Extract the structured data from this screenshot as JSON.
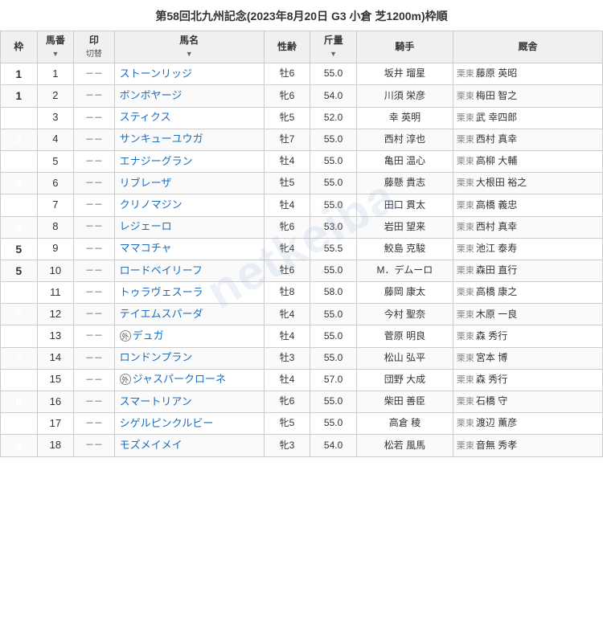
{
  "title": "第58回北九州記念(2023年8月20日 G3 小倉 芝1200m)枠順",
  "headers": {
    "waku": "枠",
    "bango": "馬番",
    "in": "印",
    "in_sub": "切替",
    "name": "馬名",
    "sex_age": "性齢",
    "weight": "斤量",
    "jockey": "騎手",
    "stable": "厩舎"
  },
  "horses": [
    {
      "waku": 1,
      "bango": 1,
      "in": "－－",
      "name": "ストーンリッジ",
      "sex_age": "牡6",
      "weight": "55.0",
      "jockey": "坂井 瑠星",
      "stable_region": "栗東",
      "stable": "藤原 英昭",
      "foreign": false
    },
    {
      "waku": 1,
      "bango": 2,
      "in": "－－",
      "name": "ボンボヤージ",
      "sex_age": "牝6",
      "weight": "54.0",
      "jockey": "川須 栄彦",
      "stable_region": "栗東",
      "stable": "梅田 智之",
      "foreign": false
    },
    {
      "waku": 2,
      "bango": 3,
      "in": "－－",
      "name": "スティクス",
      "sex_age": "牝5",
      "weight": "52.0",
      "jockey": "幸 英明",
      "stable_region": "栗東",
      "stable": "武 幸四郎",
      "foreign": false
    },
    {
      "waku": 2,
      "bango": 4,
      "in": "－－",
      "name": "サンキューユウガ",
      "sex_age": "牡7",
      "weight": "55.0",
      "jockey": "西村 淳也",
      "stable_region": "栗東",
      "stable": "西村 真幸",
      "foreign": false
    },
    {
      "waku": 3,
      "bango": 5,
      "in": "－－",
      "name": "エナジーグラン",
      "sex_age": "牡4",
      "weight": "55.0",
      "jockey": "亀田 温心",
      "stable_region": "栗東",
      "stable": "高柳 大輔",
      "foreign": false
    },
    {
      "waku": 3,
      "bango": 6,
      "in": "－－",
      "name": "リブレーザ",
      "sex_age": "牡5",
      "weight": "55.0",
      "jockey": "藤懸 貴志",
      "stable_region": "栗東",
      "stable": "大根田 裕之",
      "foreign": false
    },
    {
      "waku": 4,
      "bango": 7,
      "in": "－－",
      "name": "クリノマジン",
      "sex_age": "牡4",
      "weight": "55.0",
      "jockey": "田口 貫太",
      "stable_region": "栗東",
      "stable": "高橋 義忠",
      "foreign": false
    },
    {
      "waku": 4,
      "bango": 8,
      "in": "－－",
      "name": "レジェーロ",
      "sex_age": "牝6",
      "weight": "53.0",
      "jockey": "岩田 望来",
      "stable_region": "栗東",
      "stable": "西村 真幸",
      "foreign": false
    },
    {
      "waku": 5,
      "bango": 9,
      "in": "－－",
      "name": "ママコチャ",
      "sex_age": "牝4",
      "weight": "55.5",
      "jockey": "鮫島 克駿",
      "stable_region": "栗東",
      "stable": "池江 泰寿",
      "foreign": false
    },
    {
      "waku": 5,
      "bango": 10,
      "in": "－－",
      "name": "ロードベイリーフ",
      "sex_age": "牡6",
      "weight": "55.0",
      "jockey": "M．デムーロ",
      "stable_region": "栗東",
      "stable": "森田 直行",
      "foreign": false
    },
    {
      "waku": 6,
      "bango": 11,
      "in": "－－",
      "name": "トゥラヴェスーラ",
      "sex_age": "牡8",
      "weight": "58.0",
      "jockey": "藤岡 康太",
      "stable_region": "栗東",
      "stable": "高橋 康之",
      "foreign": false
    },
    {
      "waku": 6,
      "bango": 12,
      "in": "－－",
      "name": "テイエムスパーダ",
      "sex_age": "牝4",
      "weight": "55.0",
      "jockey": "今村 聖奈",
      "stable_region": "栗東",
      "stable": "木原 一良",
      "foreign": false
    },
    {
      "waku": 7,
      "bango": 13,
      "in": "－－",
      "name": "デュガ",
      "sex_age": "牡4",
      "weight": "55.0",
      "jockey": "菅原 明良",
      "stable_region": "栗東",
      "stable": "森 秀行",
      "foreign": true
    },
    {
      "waku": 7,
      "bango": 14,
      "in": "－－",
      "name": "ロンドンプラン",
      "sex_age": "牡3",
      "weight": "55.0",
      "jockey": "松山 弘平",
      "stable_region": "栗東",
      "stable": "宮本 博",
      "foreign": false
    },
    {
      "waku": 7,
      "bango": 15,
      "in": "－－",
      "name": "ジャスパークローネ",
      "sex_age": "牡4",
      "weight": "57.0",
      "jockey": "団野 大成",
      "stable_region": "栗東",
      "stable": "森 秀行",
      "foreign": true
    },
    {
      "waku": 8,
      "bango": 16,
      "in": "－－",
      "name": "スマートリアン",
      "sex_age": "牝6",
      "weight": "55.0",
      "jockey": "柴田 善臣",
      "stable_region": "栗東",
      "stable": "石橋 守",
      "foreign": false
    },
    {
      "waku": 8,
      "bango": 17,
      "in": "－－",
      "name": "シゲルピンクルビー",
      "sex_age": "牝5",
      "weight": "55.0",
      "jockey": "高倉 稜",
      "stable_region": "栗東",
      "stable": "渡辺 薫彦",
      "foreign": false
    },
    {
      "waku": 8,
      "bango": 18,
      "in": "－－",
      "name": "モズメイメイ",
      "sex_age": "牝3",
      "weight": "54.0",
      "jockey": "松若 風馬",
      "stable_region": "栗東",
      "stable": "音無 秀孝",
      "foreign": false
    }
  ],
  "watermark": "netkeiba"
}
